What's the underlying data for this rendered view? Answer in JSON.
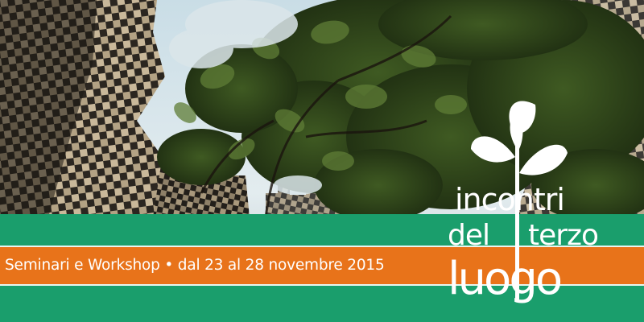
{
  "banner": {
    "tagline": "Seminari e Workshop • dal 23 al 28 novembre 2015",
    "logo": {
      "word_1": "incontri",
      "word_2": "del",
      "word_3": "terzo",
      "word_4": "luogo"
    }
  },
  "colors": {
    "green_band": "#1a9e6c",
    "orange_band": "#e8731a",
    "text": "#ffffff"
  }
}
